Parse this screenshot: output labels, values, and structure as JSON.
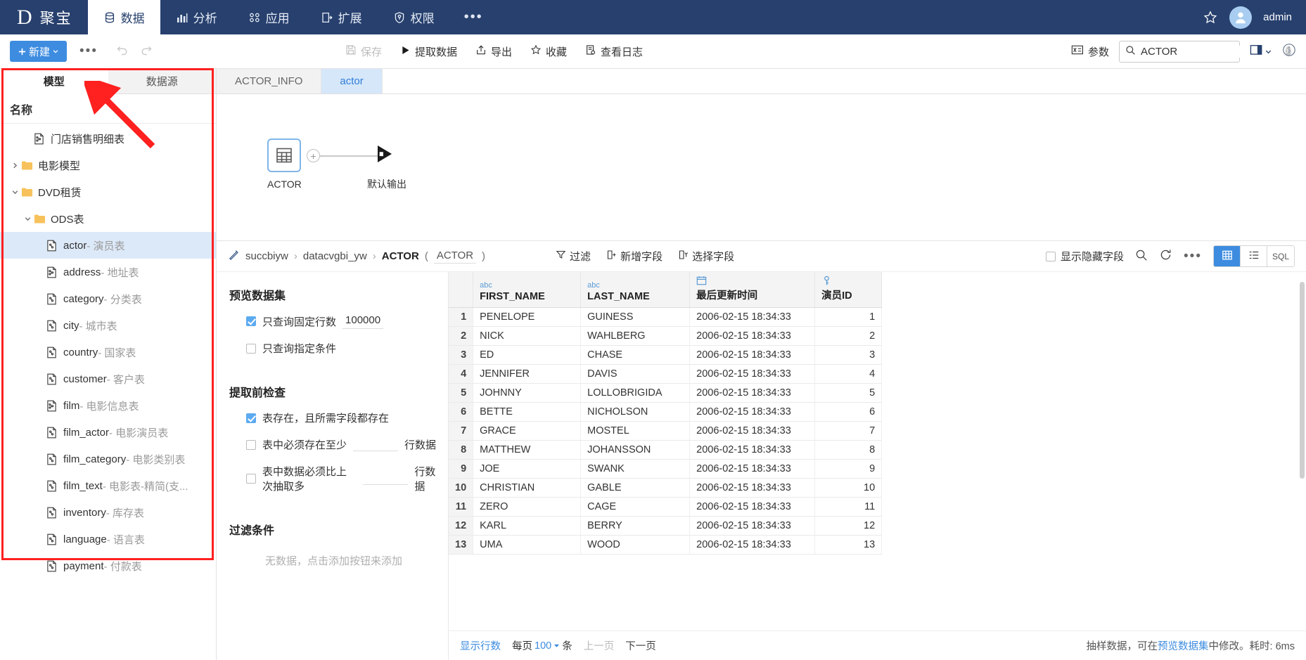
{
  "topnav": {
    "brand_logo": "D",
    "brand_name": "聚宝",
    "items": [
      {
        "label": "数据",
        "icon": "database-icon",
        "active": true
      },
      {
        "label": "分析",
        "icon": "chart-icon",
        "active": false
      },
      {
        "label": "应用",
        "icon": "apps-icon",
        "active": false
      },
      {
        "label": "扩展",
        "icon": "extension-icon",
        "active": false
      },
      {
        "label": "权限",
        "icon": "shield-icon",
        "active": false
      }
    ],
    "more": "•••",
    "user": "admin"
  },
  "toolbar": {
    "new_label": "新建",
    "more": "•••",
    "actions": [
      {
        "label": "保存",
        "icon": "save-icon",
        "disabled": true
      },
      {
        "label": "提取数据",
        "icon": "play-icon",
        "disabled": false
      },
      {
        "label": "导出",
        "icon": "export-icon",
        "disabled": false
      },
      {
        "label": "收藏",
        "icon": "star-icon",
        "disabled": false
      },
      {
        "label": "查看日志",
        "icon": "log-icon",
        "disabled": false
      }
    ],
    "param_label": "参数",
    "search_value": "ACTOR",
    "search_placeholder": "搜索"
  },
  "sidebar": {
    "tabs": [
      {
        "label": "模型",
        "active": true
      },
      {
        "label": "数据源",
        "active": false
      }
    ],
    "header": "名称",
    "tree": [
      {
        "label": "门店销售明细表",
        "desc": "",
        "indent": 1,
        "type": "file-link",
        "twisty": "",
        "selected": false
      },
      {
        "label": "电影模型",
        "desc": "",
        "indent": 0,
        "type": "folder",
        "twisty": "collapsed",
        "selected": false
      },
      {
        "label": "DVD租赁",
        "desc": "",
        "indent": 0,
        "type": "folder",
        "twisty": "expanded",
        "selected": false
      },
      {
        "label": "ODS表",
        "desc": "",
        "indent": 1,
        "type": "folder",
        "twisty": "expanded",
        "selected": false
      },
      {
        "label": "actor",
        "desc": "- 演员表",
        "indent": 2,
        "type": "file",
        "twisty": "",
        "selected": true
      },
      {
        "label": "address",
        "desc": "- 地址表",
        "indent": 2,
        "type": "file-link",
        "twisty": "",
        "selected": false
      },
      {
        "label": "category",
        "desc": "- 分类表",
        "indent": 2,
        "type": "file",
        "twisty": "",
        "selected": false
      },
      {
        "label": "city",
        "desc": "- 城市表",
        "indent": 2,
        "type": "file",
        "twisty": "",
        "selected": false
      },
      {
        "label": "country",
        "desc": "- 国家表",
        "indent": 2,
        "type": "file",
        "twisty": "",
        "selected": false
      },
      {
        "label": "customer",
        "desc": "- 客户表",
        "indent": 2,
        "type": "file",
        "twisty": "",
        "selected": false
      },
      {
        "label": "film",
        "desc": "- 电影信息表",
        "indent": 2,
        "type": "file-link",
        "twisty": "",
        "selected": false
      },
      {
        "label": "film_actor",
        "desc": "- 电影演员表",
        "indent": 2,
        "type": "file",
        "twisty": "",
        "selected": false
      },
      {
        "label": "film_category",
        "desc": "- 电影类别表",
        "indent": 2,
        "type": "file",
        "twisty": "",
        "selected": false
      },
      {
        "label": "film_text",
        "desc": "- 电影表-精简(支...",
        "indent": 2,
        "type": "file",
        "twisty": "",
        "selected": false
      },
      {
        "label": "inventory",
        "desc": "- 库存表",
        "indent": 2,
        "type": "file",
        "twisty": "",
        "selected": false
      },
      {
        "label": "language",
        "desc": "- 语言表",
        "indent": 2,
        "type": "file",
        "twisty": "",
        "selected": false
      },
      {
        "label": "payment",
        "desc": "- 付款表",
        "indent": 2,
        "type": "file",
        "twisty": "",
        "selected": false
      }
    ]
  },
  "doc_tabs": [
    {
      "label": "ACTOR_INFO",
      "active": false
    },
    {
      "label": "actor",
      "active": true
    }
  ],
  "canvas": {
    "node_label": "ACTOR",
    "plus": "+",
    "output_label": "默认输出"
  },
  "crumb": {
    "root": "succbiyw",
    "schema": "datacvgbi_yw",
    "table": "ACTOR",
    "alias": "ACTOR",
    "open_paren": "(",
    "close_paren": ")",
    "sep": "›",
    "actions": [
      {
        "label": "过滤",
        "icon": "filter-icon"
      },
      {
        "label": "新增字段",
        "icon": "add-field-icon"
      },
      {
        "label": "选择字段",
        "icon": "select-field-icon"
      }
    ],
    "show_hidden_label": "显示隐藏字段",
    "show_hidden_checked": false,
    "more": "•••",
    "views": [
      {
        "label": "grid",
        "icon": "grid-icon",
        "active": true
      },
      {
        "label": "list",
        "icon": "list-icon",
        "active": false
      },
      {
        "label": "SQL",
        "icon": "sql-icon",
        "active": false
      }
    ]
  },
  "settings": {
    "preview_title": "预览数据集",
    "opt_fixed_rows_label": "只查询固定行数",
    "opt_fixed_rows_value": "100000",
    "opt_fixed_rows_checked": true,
    "opt_condition_label": "只查询指定条件",
    "opt_condition_checked": false,
    "precheck_title": "提取前检查",
    "chk_table_exists_label": "表存在，且所需字段都存在",
    "chk_table_exists_checked": true,
    "chk_min_rows_label": "表中必须存在至少",
    "chk_min_rows_value": "",
    "chk_min_rows_suffix": "行数据",
    "chk_min_rows_checked": false,
    "chk_more_than_last_label": "表中数据必须比上次抽取多",
    "chk_more_than_last_value": "",
    "chk_more_than_last_suffix": "行数据",
    "chk_more_than_last_checked": false,
    "filter_title": "过滤条件",
    "filter_empty": "无数据，点击添加按钮来添加"
  },
  "table": {
    "index_header": "",
    "columns": [
      {
        "name": "FIRST_NAME",
        "type_icon": "abc",
        "cls": "col-fn"
      },
      {
        "name": "LAST_NAME",
        "type_icon": "abc",
        "cls": "col-ln"
      },
      {
        "name": "最后更新时间",
        "type_icon": "calendar",
        "cls": "col-dt"
      },
      {
        "name": "演员ID",
        "type_icon": "key",
        "cls": "col-id"
      }
    ],
    "rows": [
      {
        "i": "1",
        "first": "PENELOPE",
        "last": "GUINESS",
        "dt": "2006-02-15 18:34:33",
        "id": "1"
      },
      {
        "i": "2",
        "first": "NICK",
        "last": "WAHLBERG",
        "dt": "2006-02-15 18:34:33",
        "id": "2"
      },
      {
        "i": "3",
        "first": "ED",
        "last": "CHASE",
        "dt": "2006-02-15 18:34:33",
        "id": "3"
      },
      {
        "i": "4",
        "first": "JENNIFER",
        "last": "DAVIS",
        "dt": "2006-02-15 18:34:33",
        "id": "4"
      },
      {
        "i": "5",
        "first": "JOHNNY",
        "last": "LOLLOBRIGIDA",
        "dt": "2006-02-15 18:34:33",
        "id": "5"
      },
      {
        "i": "6",
        "first": "BETTE",
        "last": "NICHOLSON",
        "dt": "2006-02-15 18:34:33",
        "id": "6"
      },
      {
        "i": "7",
        "first": "GRACE",
        "last": "MOSTEL",
        "dt": "2006-02-15 18:34:33",
        "id": "7"
      },
      {
        "i": "8",
        "first": "MATTHEW",
        "last": "JOHANSSON",
        "dt": "2006-02-15 18:34:33",
        "id": "8"
      },
      {
        "i": "9",
        "first": "JOE",
        "last": "SWANK",
        "dt": "2006-02-15 18:34:33",
        "id": "9"
      },
      {
        "i": "10",
        "first": "CHRISTIAN",
        "last": "GABLE",
        "dt": "2006-02-15 18:34:33",
        "id": "10"
      },
      {
        "i": "11",
        "first": "ZERO",
        "last": "CAGE",
        "dt": "2006-02-15 18:34:33",
        "id": "11"
      },
      {
        "i": "12",
        "first": "KARL",
        "last": "BERRY",
        "dt": "2006-02-15 18:34:33",
        "id": "12"
      },
      {
        "i": "13",
        "first": "UMA",
        "last": "WOOD",
        "dt": "2006-02-15 18:34:33",
        "id": "13"
      }
    ]
  },
  "footer": {
    "show_rows": "显示行数",
    "per_page_prefix": "每页",
    "per_page_value": "100",
    "per_page_suffix": "条",
    "prev_page": "上一页",
    "next_page": "下一页",
    "status_prefix": "抽样数据，可在",
    "status_link": "预览数据集",
    "status_suffix": "中修改。耗时: 6ms"
  },
  "colors": {
    "nav_bg": "#27406e",
    "accent": "#3d8ce0",
    "tab_active": "#d6e7fa",
    "annotation": "#ff2020"
  }
}
